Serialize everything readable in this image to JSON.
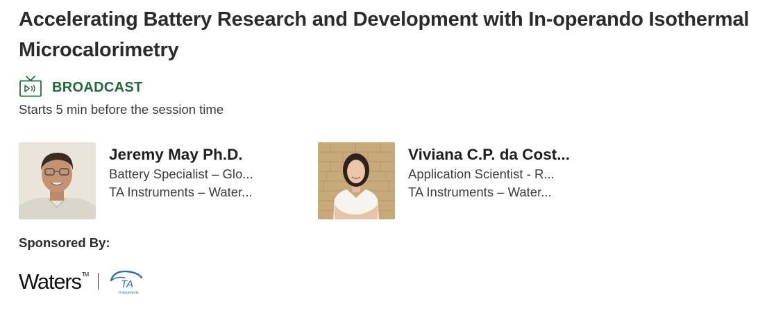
{
  "session": {
    "title": "Accelerating Battery Research and Development with In-operando Isothermal Microcalorimetry",
    "format_label": "BROADCAST",
    "format_icon": "tv-broadcast-icon",
    "starts_note": "Starts 5 min before the session time"
  },
  "speakers": [
    {
      "name": "Jeremy May Ph.D.",
      "role": "Battery Specialist – Glo...",
      "company": "TA Instruments – Water...",
      "photo": "speaker-photo"
    },
    {
      "name": "Viviana C.P. da Cost...",
      "role": "Application Scientist - R...",
      "company": "TA Instruments – Water...",
      "photo": "speaker-photo"
    }
  ],
  "sponsors": {
    "heading": "Sponsored By:",
    "waters_logo": "Waters",
    "waters_tm": "TM",
    "ta_logo_text": "TA",
    "ta_logo_subtext": "Instruments"
  },
  "colors": {
    "broadcast_green": "#1e6b3a",
    "ta_blue": "#2d6fae"
  }
}
